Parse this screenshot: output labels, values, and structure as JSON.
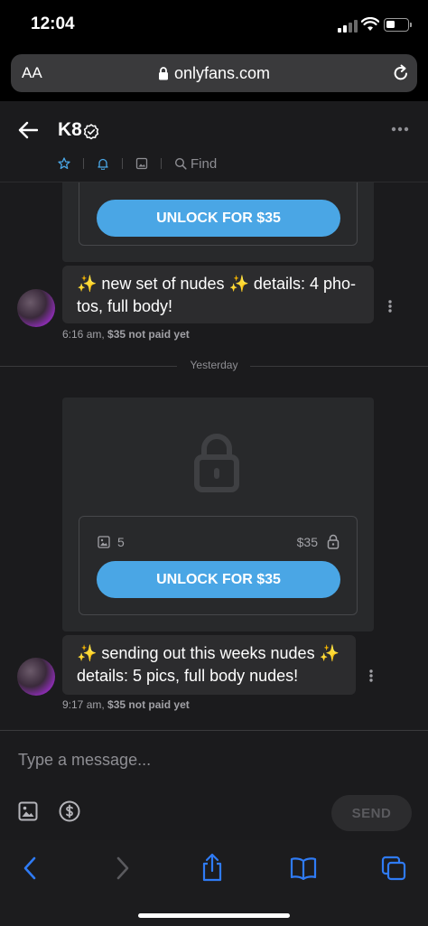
{
  "status_bar": {
    "time": "12:04"
  },
  "browser": {
    "text_size_label": "AA",
    "url": "onlyfans.com"
  },
  "chat": {
    "contact_name": "K8",
    "subbar": {
      "find_label": "Find"
    },
    "messages": [
      {
        "unlock_label": "UNLOCK FOR $35",
        "text": "✨ new set of nudes ✨ details: 4 pho-tos, full body!",
        "time": "6:16 am,",
        "status": "$35 not paid yet"
      },
      {
        "media_count": "5",
        "price": "$35",
        "unlock_label": "UNLOCK FOR $35",
        "text": "✨ sending out this weeks nudes ✨ details: 5 pics, full body nudes!",
        "time": "9:17 am,",
        "status": "$35 not paid yet"
      }
    ],
    "day_separator": "Yesterday"
  },
  "composer": {
    "placeholder": "Type a message...",
    "send_label": "SEND"
  },
  "colors": {
    "accent": "#4aa6e5",
    "background": "#1b1b1d",
    "bubble": "#2c2c2e",
    "toolbar_icon": "#2f7bf5"
  }
}
